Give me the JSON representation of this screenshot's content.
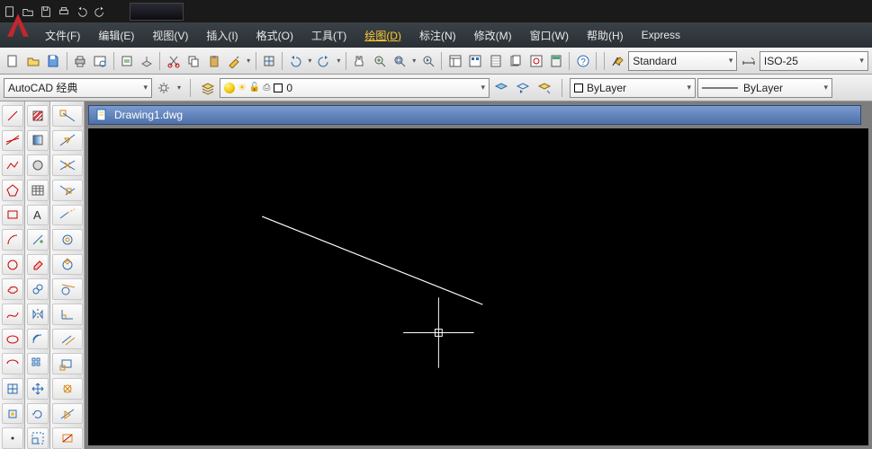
{
  "menu": {
    "items": [
      {
        "label": "文件(F)"
      },
      {
        "label": "编辑(E)"
      },
      {
        "label": "视图(V)"
      },
      {
        "label": "插入(I)"
      },
      {
        "label": "格式(O)"
      },
      {
        "label": "工具(T)"
      },
      {
        "label": "绘图(D)",
        "active": true
      },
      {
        "label": "标注(N)"
      },
      {
        "label": "修改(M)"
      },
      {
        "label": "窗口(W)"
      },
      {
        "label": "帮助(H)"
      },
      {
        "label": "Express"
      }
    ]
  },
  "workspace": {
    "value": "AutoCAD 经典"
  },
  "layer": {
    "value": "0"
  },
  "textstyle": {
    "value": "Standard"
  },
  "dimstyle": {
    "value": "ISO-25"
  },
  "bylayer": {
    "value": "ByLayer"
  },
  "linetype": {
    "value": "ByLayer"
  },
  "doc": {
    "title": "Drawing1.dwg"
  }
}
